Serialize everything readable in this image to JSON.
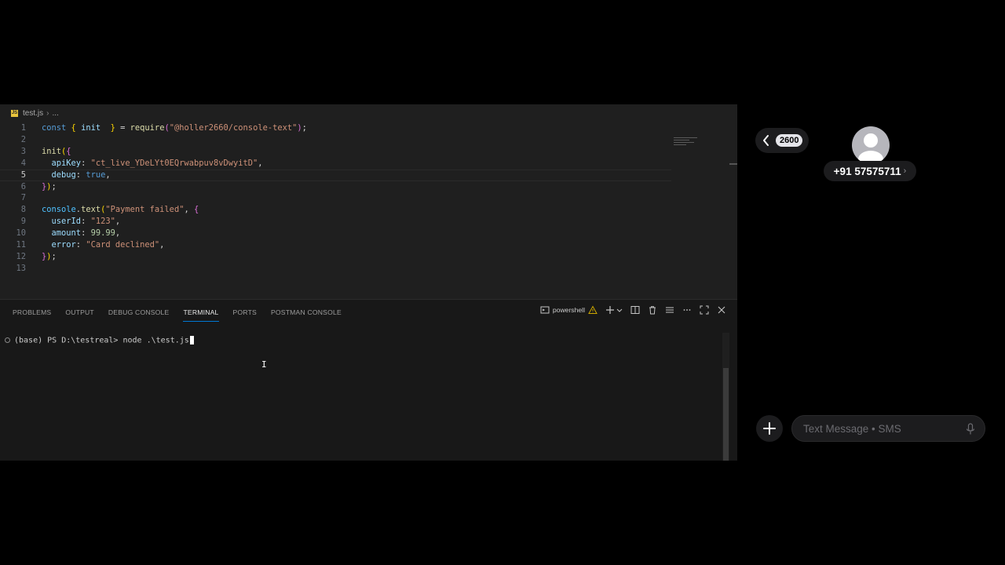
{
  "editor": {
    "file_tab": "test.js",
    "breadcrumb_more": "...",
    "lines": [
      {
        "n": "1",
        "tokens": [
          [
            "k",
            "const "
          ],
          [
            "b1",
            "{ "
          ],
          [
            "p",
            "init"
          ],
          [
            "",
            "  "
          ],
          [
            "b1",
            "}"
          ],
          [
            "",
            " = "
          ],
          [
            "f",
            "require"
          ],
          [
            "b2",
            "("
          ],
          [
            "s",
            "\"@holler2660/console-text\""
          ],
          [
            "b2",
            ")"
          ],
          [
            "",
            ";"
          ]
        ]
      },
      {
        "n": "2",
        "tokens": []
      },
      {
        "n": "3",
        "tokens": [
          [
            "f",
            "init"
          ],
          [
            "b1",
            "("
          ],
          [
            "b2",
            "{"
          ]
        ]
      },
      {
        "n": "4",
        "tokens": [
          [
            "",
            "  "
          ],
          [
            "p",
            "apiKey"
          ],
          [
            "",
            ": "
          ],
          [
            "s",
            "\"ct_live_YDeLYt0EQrwabpuv8vDwyitD\""
          ],
          [
            "",
            ","
          ]
        ]
      },
      {
        "n": "5",
        "tokens": [
          [
            "",
            "  "
          ],
          [
            "p",
            "debug"
          ],
          [
            "",
            ": "
          ],
          [
            "k",
            "true"
          ],
          [
            "",
            ","
          ]
        ],
        "active": true
      },
      {
        "n": "6",
        "tokens": [
          [
            "b2",
            "}"
          ],
          [
            "b1",
            ")"
          ],
          [
            "",
            ";"
          ]
        ]
      },
      {
        "n": "7",
        "tokens": []
      },
      {
        "n": "8",
        "tokens": [
          [
            "v",
            "console"
          ],
          [
            "",
            "."
          ],
          [
            "f",
            "text"
          ],
          [
            "b1",
            "("
          ],
          [
            "s",
            "\"Payment failed\""
          ],
          [
            "",
            ", "
          ],
          [
            "b2",
            "{"
          ]
        ]
      },
      {
        "n": "9",
        "tokens": [
          [
            "",
            "  "
          ],
          [
            "p",
            "userId"
          ],
          [
            "",
            ": "
          ],
          [
            "s",
            "\"123\""
          ],
          [
            "",
            ","
          ]
        ]
      },
      {
        "n": "10",
        "tokens": [
          [
            "",
            "  "
          ],
          [
            "p",
            "amount"
          ],
          [
            "",
            ": "
          ],
          [
            "n",
            "99.99"
          ],
          [
            "",
            ","
          ]
        ]
      },
      {
        "n": "11",
        "tokens": [
          [
            "",
            "  "
          ],
          [
            "p",
            "error"
          ],
          [
            "",
            ": "
          ],
          [
            "s",
            "\"Card declined\""
          ],
          [
            "",
            ","
          ]
        ]
      },
      {
        "n": "12",
        "tokens": [
          [
            "b2",
            "}"
          ],
          [
            "b1",
            ")"
          ],
          [
            "",
            ";"
          ]
        ]
      },
      {
        "n": "13",
        "tokens": []
      }
    ]
  },
  "panel": {
    "tabs": [
      "PROBLEMS",
      "OUTPUT",
      "DEBUG CONSOLE",
      "TERMINAL",
      "PORTS",
      "POSTMAN CONSOLE"
    ],
    "active_tab": "TERMINAL",
    "terminal_name": "powershell"
  },
  "terminal": {
    "prompt": "(base) PS D:\\testreal> ",
    "command": "node .\\test.js"
  },
  "messages": {
    "badge_count": "2600",
    "contact": "+91 57575711",
    "input_placeholder": "Text Message • SMS"
  },
  "colors": {
    "accent": "#0078d4",
    "editor_bg": "#1f1f1f",
    "panel_bg": "#181818",
    "messages_pill": "#1c1c1e"
  }
}
